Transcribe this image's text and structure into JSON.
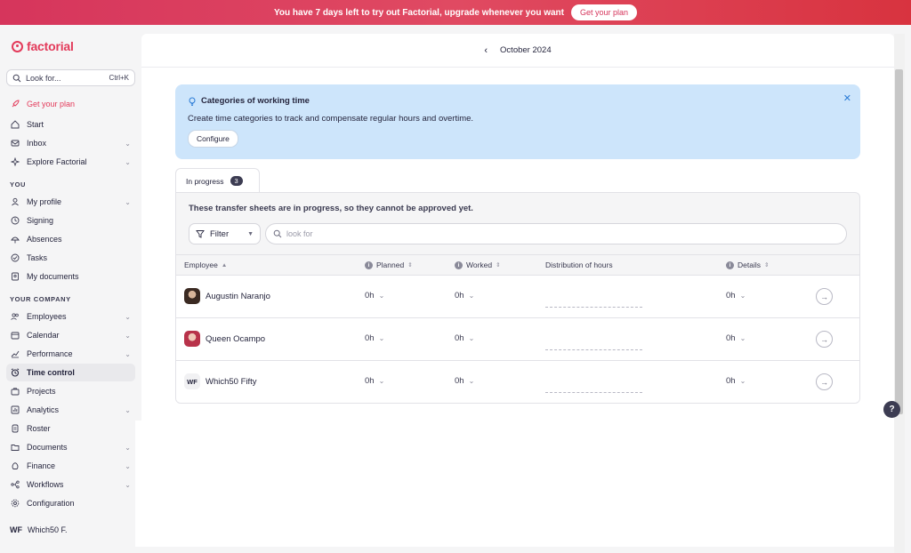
{
  "banner": {
    "text": "You have 7 days left to try out Factorial, upgrade whenever you want",
    "button": "Get your plan"
  },
  "sidebar": {
    "logo": "factorial",
    "search_label": "Look for...",
    "search_shortcut": "Ctrl+K",
    "items": [
      {
        "label": "Get your plan",
        "icon": "rocket-icon"
      },
      {
        "label": "Start",
        "icon": "home-icon"
      },
      {
        "label": "Inbox",
        "icon": "inbox-icon"
      },
      {
        "label": "Explore Factorial",
        "icon": "explore-icon"
      },
      {
        "label": "My profile",
        "icon": "user-icon"
      },
      {
        "label": "Signing",
        "icon": "clock-icon"
      },
      {
        "label": "Absences",
        "icon": "absences-icon"
      },
      {
        "label": "Tasks",
        "icon": "check-icon"
      },
      {
        "label": "My documents",
        "icon": "document-icon"
      },
      {
        "label": "Employees",
        "icon": "users-icon"
      },
      {
        "label": "Calendar",
        "icon": "calendar-icon"
      },
      {
        "label": "Performance",
        "icon": "chart-line-icon"
      },
      {
        "label": "Time control",
        "icon": "alarm-icon"
      },
      {
        "label": "Projects",
        "icon": "briefcase-icon"
      },
      {
        "label": "Analytics",
        "icon": "analytics-icon"
      },
      {
        "label": "Roster",
        "icon": "roster-icon"
      },
      {
        "label": "Documents",
        "icon": "folder-icon"
      },
      {
        "label": "Finance",
        "icon": "finance-icon"
      },
      {
        "label": "Workflows",
        "icon": "workflow-icon"
      },
      {
        "label": "Configuration",
        "icon": "gear-icon"
      }
    ],
    "section_you": "YOU",
    "section_company": "YOUR COMPANY",
    "user_initials": "WF",
    "user_name": "Which50 F."
  },
  "header": {
    "month": "October 2024"
  },
  "info_card": {
    "title": "Categories of working time",
    "description": "Create time categories to track and compensate regular hours and overtime.",
    "button": "Configure"
  },
  "tab": {
    "label": "In progress",
    "count": "3"
  },
  "table": {
    "notice": "These transfer sheets are in progress, so they cannot be approved yet.",
    "filter_label": "Filter",
    "search_placeholder": "look for",
    "columns": {
      "employee": "Employee",
      "planned": "Planned",
      "worked": "Worked",
      "distribution": "Distribution of hours",
      "details": "Details"
    },
    "rows": [
      {
        "initials": "",
        "name": "Augustin Naranjo",
        "planned": "0h",
        "worked": "0h",
        "details": "0h"
      },
      {
        "initials": "",
        "name": "Queen Ocampo",
        "planned": "0h",
        "worked": "0h",
        "details": "0h"
      },
      {
        "initials": "WF",
        "name": "Which50 Fifty",
        "planned": "0h",
        "worked": "0h",
        "details": "0h"
      }
    ]
  },
  "help_label": "?",
  "colors": {
    "brand": "#e33a5a",
    "info_bg": "#cde5fb",
    "badge": "#3c3c52"
  }
}
